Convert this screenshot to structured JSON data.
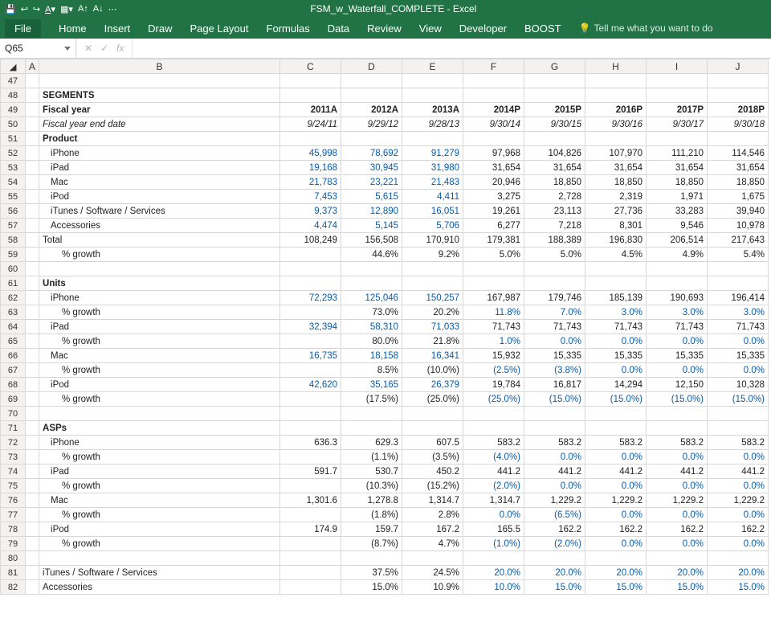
{
  "app": {
    "title": "FSM_w_Waterfall_COMPLETE  -  Excel"
  },
  "ribbon": {
    "tabs": [
      "File",
      "Home",
      "Insert",
      "Draw",
      "Page Layout",
      "Formulas",
      "Data",
      "Review",
      "View",
      "Developer",
      "BOOST"
    ],
    "tell_me": "Tell me what you want to do"
  },
  "namebox": "Q65",
  "fx_icons": {
    "cancel": "✕",
    "accept": "✓",
    "fx": "fx"
  },
  "columns": [
    "A",
    "B",
    "C",
    "D",
    "E",
    "F",
    "G",
    "H",
    "I",
    "J"
  ],
  "row_start": 47,
  "row_end": 82,
  "labels": {
    "segments": "SEGMENTS",
    "fiscal_year": "Fiscal year",
    "fy_end": "Fiscal year end date",
    "product": "Product",
    "iphone": "iPhone",
    "ipad": "iPad",
    "mac": "Mac",
    "ipod": "iPod",
    "its": "iTunes / Software / Services",
    "acc": "Accessories",
    "total": "Total",
    "growth": "% growth",
    "units": "Units",
    "asps": "ASPs"
  },
  "years": [
    "2011A",
    "2012A",
    "2013A",
    "2014P",
    "2015P",
    "2016P",
    "2017P",
    "2018P"
  ],
  "dates": [
    "9/24/11",
    "9/29/12",
    "9/28/13",
    "9/30/14",
    "9/30/15",
    "9/30/16",
    "9/30/17",
    "9/30/18"
  ],
  "prod": {
    "iphone": [
      "45,998",
      "78,692",
      "91,279",
      "97,968",
      "104,826",
      "107,970",
      "111,210",
      "114,546"
    ],
    "ipad": [
      "19,168",
      "30,945",
      "31,980",
      "31,654",
      "31,654",
      "31,654",
      "31,654",
      "31,654"
    ],
    "mac": [
      "21,783",
      "23,221",
      "21,483",
      "20,946",
      "18,850",
      "18,850",
      "18,850",
      "18,850"
    ],
    "ipod": [
      "7,453",
      "5,615",
      "4,411",
      "3,275",
      "2,728",
      "2,319",
      "1,971",
      "1,675"
    ],
    "its": [
      "9,373",
      "12,890",
      "16,051",
      "19,261",
      "23,113",
      "27,736",
      "33,283",
      "39,940"
    ],
    "acc": [
      "4,474",
      "5,145",
      "5,706",
      "6,277",
      "7,218",
      "8,301",
      "9,546",
      "10,978"
    ],
    "total": [
      "108,249",
      "156,508",
      "170,910",
      "179,381",
      "188,389",
      "196,830",
      "206,514",
      "217,643"
    ],
    "growth": [
      "",
      "44.6%",
      "9.2%",
      "5.0%",
      "5.0%",
      "4.5%",
      "4.9%",
      "5.4%"
    ]
  },
  "units": {
    "iphone": [
      "72,293",
      "125,046",
      "150,257",
      "167,987",
      "179,746",
      "185,139",
      "190,693",
      "196,414"
    ],
    "iphone_g": [
      "",
      "73.0%",
      "20.2%",
      "11.8%",
      "7.0%",
      "3.0%",
      "3.0%",
      "3.0%"
    ],
    "ipad": [
      "32,394",
      "58,310",
      "71,033",
      "71,743",
      "71,743",
      "71,743",
      "71,743",
      "71,743"
    ],
    "ipad_g": [
      "",
      "80.0%",
      "21.8%",
      "1.0%",
      "0.0%",
      "0.0%",
      "0.0%",
      "0.0%"
    ],
    "mac": [
      "16,735",
      "18,158",
      "16,341",
      "15,932",
      "15,335",
      "15,335",
      "15,335",
      "15,335"
    ],
    "mac_g": [
      "",
      "8.5%",
      "(10.0%)",
      "(2.5%)",
      "(3.8%)",
      "0.0%",
      "0.0%",
      "0.0%"
    ],
    "ipod": [
      "42,620",
      "35,165",
      "26,379",
      "19,784",
      "16,817",
      "14,294",
      "12,150",
      "10,328"
    ],
    "ipod_g": [
      "",
      "(17.5%)",
      "(25.0%)",
      "(25.0%)",
      "(15.0%)",
      "(15.0%)",
      "(15.0%)",
      "(15.0%)"
    ]
  },
  "asps": {
    "iphone": [
      "636.3",
      "629.3",
      "607.5",
      "583.2",
      "583.2",
      "583.2",
      "583.2",
      "583.2"
    ],
    "iphone_g": [
      "",
      "(1.1%)",
      "(3.5%)",
      "(4.0%)",
      "0.0%",
      "0.0%",
      "0.0%",
      "0.0%"
    ],
    "ipad": [
      "591.7",
      "530.7",
      "450.2",
      "441.2",
      "441.2",
      "441.2",
      "441.2",
      "441.2"
    ],
    "ipad_g": [
      "",
      "(10.3%)",
      "(15.2%)",
      "(2.0%)",
      "0.0%",
      "0.0%",
      "0.0%",
      "0.0%"
    ],
    "mac": [
      "1,301.6",
      "1,278.8",
      "1,314.7",
      "1,314.7",
      "1,229.2",
      "1,229.2",
      "1,229.2",
      "1,229.2"
    ],
    "mac_g": [
      "",
      "(1.8%)",
      "2.8%",
      "0.0%",
      "(6.5%)",
      "0.0%",
      "0.0%",
      "0.0%"
    ],
    "ipod": [
      "174.9",
      "159.7",
      "167.2",
      "165.5",
      "162.2",
      "162.2",
      "162.2",
      "162.2"
    ],
    "ipod_g": [
      "",
      "(8.7%)",
      "4.7%",
      "(1.0%)",
      "(2.0%)",
      "0.0%",
      "0.0%",
      "0.0%"
    ]
  },
  "tail": {
    "its": [
      "",
      "37.5%",
      "24.5%",
      "20.0%",
      "20.0%",
      "20.0%",
      "20.0%",
      "20.0%"
    ],
    "acc": [
      "",
      "15.0%",
      "10.9%",
      "10.0%",
      "15.0%",
      "15.0%",
      "15.0%",
      "15.0%"
    ]
  },
  "blue_cols_actuals": 3,
  "blue_cols_proj_from": 3
}
